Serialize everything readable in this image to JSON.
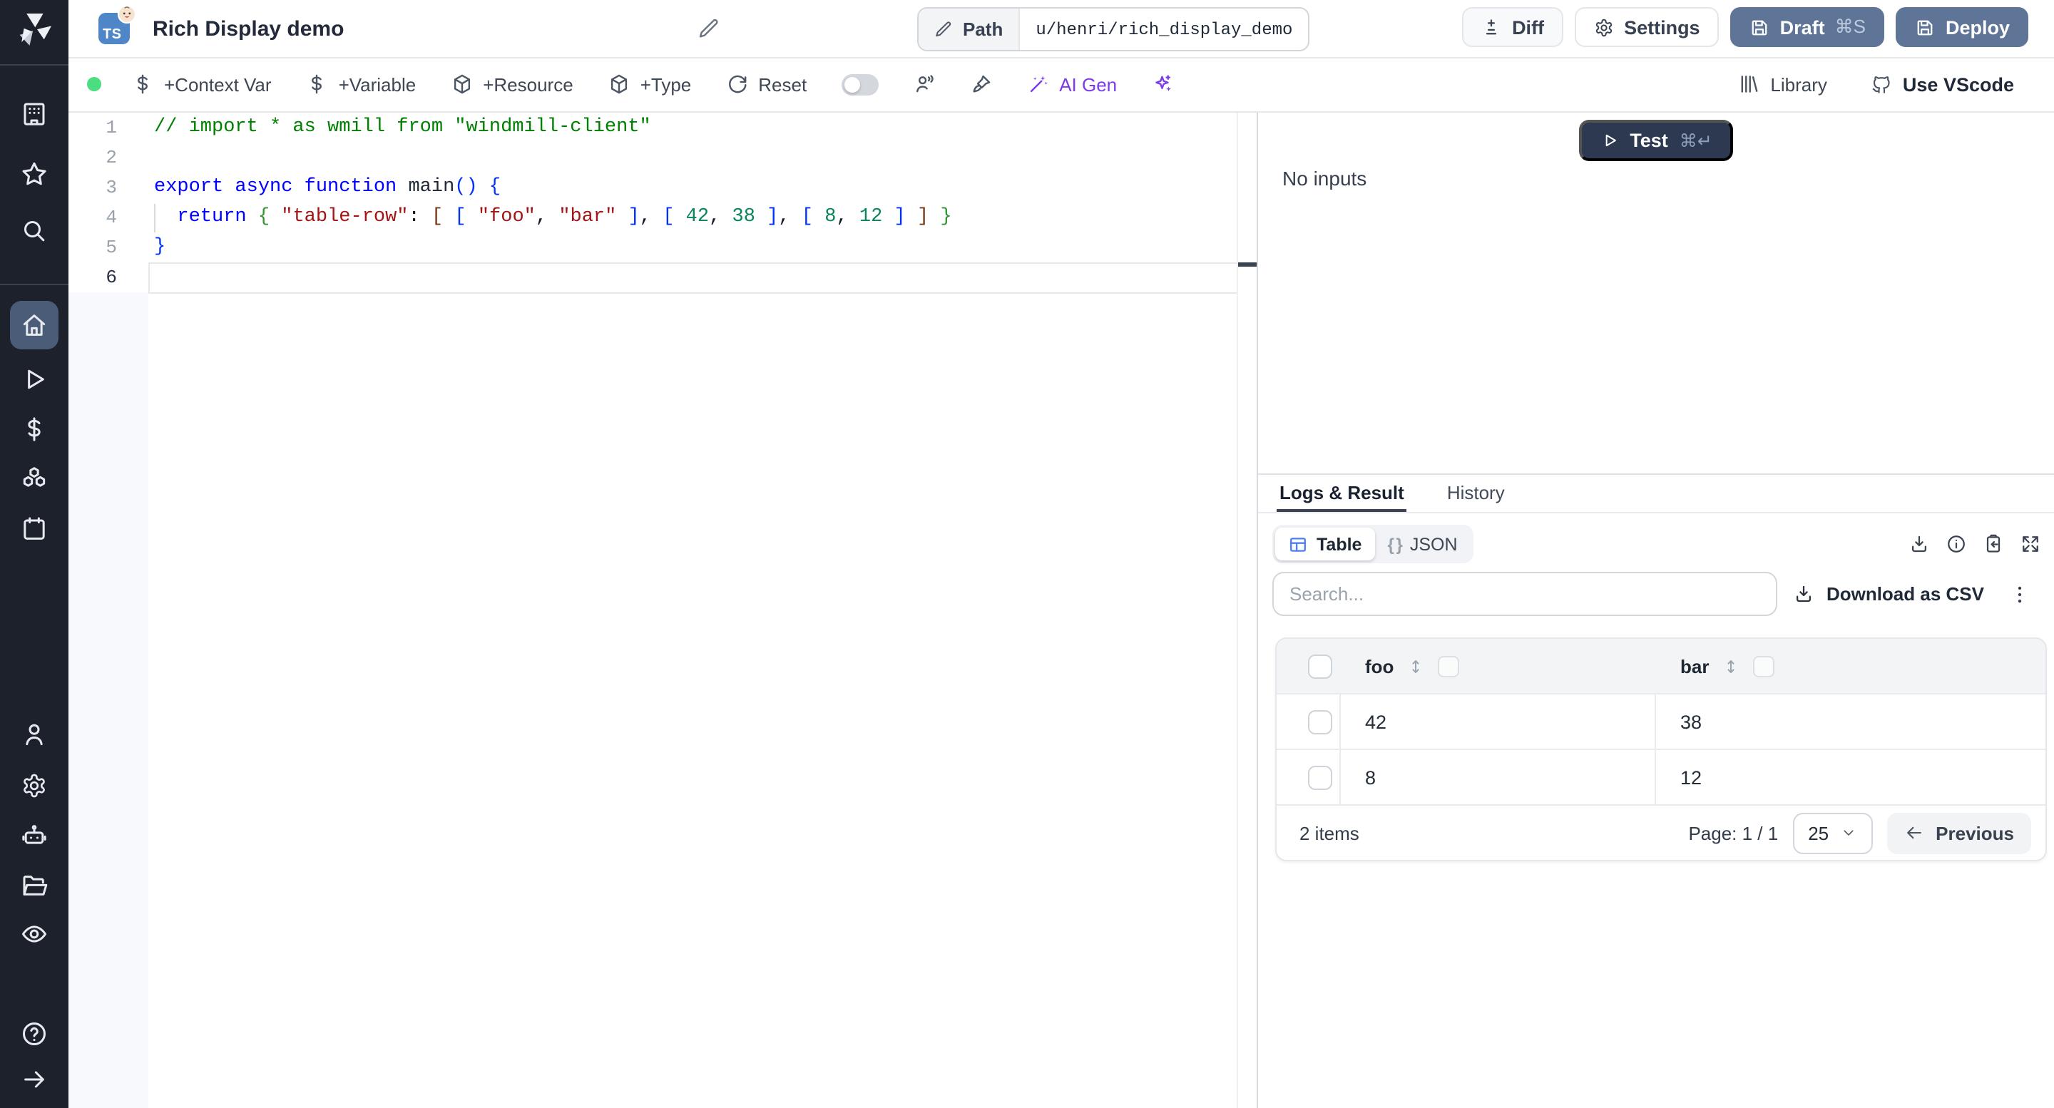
{
  "app": {
    "name": "Windmill"
  },
  "topbar": {
    "lang_badge": "TS",
    "title": "Rich Display demo",
    "path_label": "Path",
    "path_value": "u/henri/rich_display_demo",
    "diff_label": "Diff",
    "settings_label": "Settings",
    "draft_label": "Draft",
    "draft_shortcut": "⌘S",
    "deploy_label": "Deploy"
  },
  "toolbar": {
    "items": [
      {
        "name": "add-context-var",
        "icon": "dollar",
        "label": "+Context Var"
      },
      {
        "name": "add-variable",
        "icon": "dollar",
        "label": "+Variable"
      },
      {
        "name": "add-resource",
        "icon": "package",
        "label": "+Resource"
      },
      {
        "name": "add-type",
        "icon": "package",
        "label": "+Type"
      },
      {
        "name": "reset",
        "icon": "reset",
        "label": "Reset"
      },
      {
        "name": "multiplayer-toggle",
        "type": "toggle"
      },
      {
        "name": "multiplayer",
        "icon": "users",
        "type": "icon"
      },
      {
        "name": "format-code",
        "icon": "brush",
        "type": "icon"
      },
      {
        "name": "ai-gen",
        "icon": "wand",
        "label": "AI Gen",
        "accent": true
      },
      {
        "name": "ai-sparkles",
        "icon": "sparkles",
        "type": "icon",
        "accent": true
      }
    ],
    "library_label": "Library",
    "vscode_label": "Use VScode"
  },
  "sidebar": {
    "items": [
      {
        "name": "workspaces",
        "icon": "building"
      },
      {
        "name": "favorites",
        "icon": "star"
      },
      {
        "name": "search",
        "icon": "search"
      },
      {
        "name": "home",
        "icon": "home",
        "active": true
      },
      {
        "name": "runs",
        "icon": "play"
      },
      {
        "name": "variables",
        "icon": "dollar"
      },
      {
        "name": "resources",
        "icon": "boxes"
      },
      {
        "name": "schedules",
        "icon": "calendar"
      },
      {
        "name": "users",
        "icon": "user"
      },
      {
        "name": "settings",
        "icon": "gear"
      },
      {
        "name": "workers",
        "icon": "robot"
      },
      {
        "name": "folders",
        "icon": "folder"
      },
      {
        "name": "audit-logs",
        "icon": "eye"
      },
      {
        "name": "help",
        "icon": "help"
      },
      {
        "name": "expand-sidebar",
        "icon": "arrow-right"
      }
    ]
  },
  "editor": {
    "lines": [
      {
        "n": "1",
        "tokens": [
          [
            "comment",
            "// import * as wmill from \"windmill-client\""
          ]
        ]
      },
      {
        "n": "2",
        "tokens": []
      },
      {
        "n": "3",
        "tokens": [
          [
            "kw",
            "export async function "
          ],
          [
            "plain",
            "main"
          ],
          [
            "b1",
            "()"
          ],
          [
            "plain",
            " "
          ],
          [
            "b1",
            "{"
          ]
        ]
      },
      {
        "n": "4",
        "tokens": [
          [
            "plain",
            "  "
          ],
          [
            "kw",
            "return"
          ],
          [
            "plain",
            " "
          ],
          [
            "b2",
            "{"
          ],
          [
            "plain",
            " "
          ],
          [
            "str",
            "\"table-row\""
          ],
          [
            "punct",
            ":"
          ],
          [
            "plain",
            " "
          ],
          [
            "b3",
            "["
          ],
          [
            "plain",
            " "
          ],
          [
            "b1",
            "["
          ],
          [
            "plain",
            " "
          ],
          [
            "str",
            "\"foo\""
          ],
          [
            "punct",
            ","
          ],
          [
            "plain",
            " "
          ],
          [
            "str",
            "\"bar\""
          ],
          [
            "plain",
            " "
          ],
          [
            "b1",
            "]"
          ],
          [
            "punct",
            ","
          ],
          [
            "plain",
            " "
          ],
          [
            "b1",
            "["
          ],
          [
            "plain",
            " "
          ],
          [
            "num",
            "42"
          ],
          [
            "punct",
            ","
          ],
          [
            "plain",
            " "
          ],
          [
            "num",
            "38"
          ],
          [
            "plain",
            " "
          ],
          [
            "b1",
            "]"
          ],
          [
            "punct",
            ","
          ],
          [
            "plain",
            " "
          ],
          [
            "b1",
            "["
          ],
          [
            "plain",
            " "
          ],
          [
            "num",
            "8"
          ],
          [
            "punct",
            ","
          ],
          [
            "plain",
            " "
          ],
          [
            "num",
            "12"
          ],
          [
            "plain",
            " "
          ],
          [
            "b1",
            "]"
          ],
          [
            "plain",
            " "
          ],
          [
            "b3",
            "]"
          ],
          [
            "plain",
            " "
          ],
          [
            "b2",
            "}"
          ]
        ]
      },
      {
        "n": "5",
        "tokens": [
          [
            "b1",
            "}"
          ]
        ]
      },
      {
        "n": "6",
        "tokens": [],
        "active": true
      }
    ]
  },
  "panel": {
    "test_label": "Test",
    "test_shortcut": "⌘↵",
    "no_inputs": "No inputs",
    "tabs": [
      {
        "label": "Logs & Result",
        "active": true
      },
      {
        "label": "History",
        "active": false
      }
    ],
    "views": {
      "table": "Table",
      "braces": "{ }",
      "json": "JSON"
    },
    "result_actions": [
      {
        "name": "download-result",
        "icon": "download"
      },
      {
        "name": "result-info",
        "icon": "info"
      },
      {
        "name": "copy-result",
        "icon": "clipboard"
      },
      {
        "name": "expand-result",
        "icon": "expand"
      }
    ],
    "search_placeholder": "Search...",
    "download_csv_label": "Download as CSV",
    "table": {
      "columns": [
        "foo",
        "bar"
      ],
      "rows": [
        [
          "42",
          "38"
        ],
        [
          "8",
          "12"
        ]
      ],
      "items_count": "2 items",
      "page_label": "Page: 1 / 1",
      "page_size": "25",
      "previous_label": "Previous"
    }
  },
  "colors": {
    "sidebar_bg": "#1c212c",
    "sidebar_active": "#4b5c78",
    "primary_button": "#5f7598",
    "test_button": "#2c3950",
    "accent_purple": "#7c3aed",
    "status_green": "#4ade80",
    "ts_badge_blue": "#4e86c8",
    "table_icon_blue": "#4e7cf5"
  }
}
